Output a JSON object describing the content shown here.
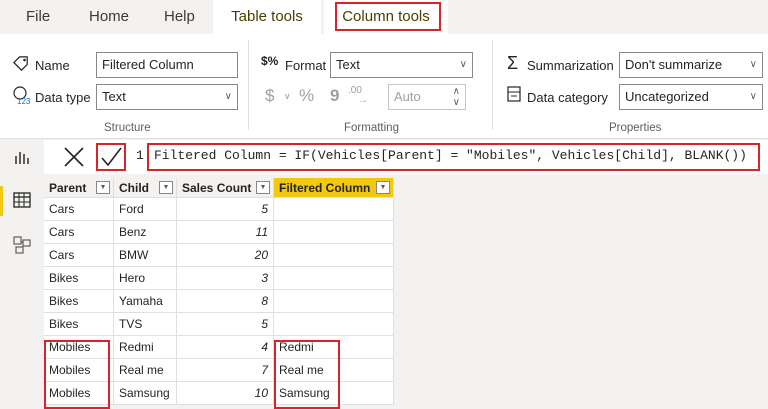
{
  "tabs": [
    "File",
    "Home",
    "Help",
    "Table tools",
    "Column tools"
  ],
  "structure": {
    "name_label": "Name",
    "name_value": "Filtered Column",
    "datatype_label": "Data type",
    "datatype_value": "Text",
    "group_label": "Structure"
  },
  "formatting": {
    "format_label": "Format",
    "format_value": "Text",
    "currency_symbol": "$",
    "percent_symbol": "%",
    "comma_symbol": "9",
    "decimal_symbol": ".00",
    "auto_value": "Auto",
    "group_label": "Formatting"
  },
  "properties": {
    "summarization_label": "Summarization",
    "summarization_value": "Don't summarize",
    "category_label": "Data category",
    "category_value": "Uncategorized",
    "group_label": "Properties"
  },
  "formula": {
    "line_number": "1",
    "text": "Filtered Column = IF(Vehicles[Parent] = \"Mobiles\", Vehicles[Child], BLANK())"
  },
  "table": {
    "headers": [
      "Parent",
      "Child",
      "Sales Count",
      "Filtered Column"
    ],
    "rows": [
      {
        "parent": "Cars",
        "child": "Ford",
        "sales": "5",
        "filtered": ""
      },
      {
        "parent": "Cars",
        "child": "Benz",
        "sales": "11",
        "filtered": ""
      },
      {
        "parent": "Cars",
        "child": "BMW",
        "sales": "20",
        "filtered": ""
      },
      {
        "parent": "Bikes",
        "child": "Hero",
        "sales": "3",
        "filtered": ""
      },
      {
        "parent": "Bikes",
        "child": "Yamaha",
        "sales": "8",
        "filtered": ""
      },
      {
        "parent": "Bikes",
        "child": "TVS",
        "sales": "5",
        "filtered": ""
      },
      {
        "parent": "Mobiles",
        "child": "Redmi",
        "sales": "4",
        "filtered": "Redmi"
      },
      {
        "parent": "Mobiles",
        "child": "Real me",
        "sales": "7",
        "filtered": "Real me"
      },
      {
        "parent": "Mobiles",
        "child": "Samsung",
        "sales": "10",
        "filtered": "Samsung"
      }
    ]
  },
  "icons": [
    "name-tag-icon",
    "data-type-icon",
    "format-icon",
    "sigma-icon",
    "data-category-icon",
    "report-view-icon",
    "data-view-icon",
    "model-view-icon",
    "cancel-icon",
    "commit-check-icon"
  ]
}
